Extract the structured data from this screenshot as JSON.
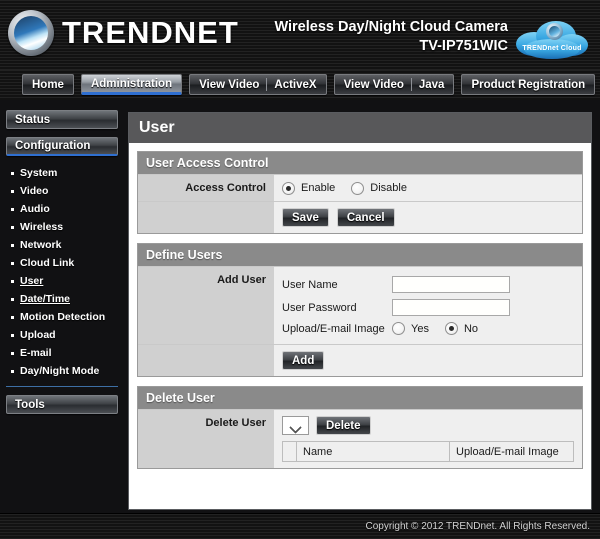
{
  "header": {
    "brand": "TRENDNET",
    "logo_icon": "trendnet-circle-logo",
    "product_line1": "Wireless Day/Night Cloud Camera",
    "product_line2": "TV-IP751WIC",
    "cloud_badge_label": "TRENDnet Cloud",
    "cloud_badge_icon": "cloud-icon"
  },
  "nav": {
    "tabs": [
      {
        "label": "Home",
        "active": false
      },
      {
        "label": "Administration",
        "active": true
      },
      {
        "label": "View Video",
        "label2": "ActiveX",
        "active": false
      },
      {
        "label": "View Video",
        "label2": "Java",
        "active": false
      },
      {
        "label": "Product Registration",
        "active": false
      }
    ]
  },
  "sidebar": {
    "status_label": "Status",
    "configuration_label": "Configuration",
    "tools_label": "Tools",
    "items": [
      {
        "label": "System",
        "active": false
      },
      {
        "label": "Video",
        "active": false
      },
      {
        "label": "Audio",
        "active": false
      },
      {
        "label": "Wireless",
        "active": false
      },
      {
        "label": "Network",
        "active": false
      },
      {
        "label": "Cloud Link",
        "active": false
      },
      {
        "label": "User",
        "active": true
      },
      {
        "label": "Date/Time",
        "active": true
      },
      {
        "label": "Motion Detection",
        "active": false
      },
      {
        "label": "Upload",
        "active": false
      },
      {
        "label": "E-mail",
        "active": false
      },
      {
        "label": "Day/Night Mode",
        "active": false
      }
    ]
  },
  "main": {
    "page_title": "User",
    "access_control": {
      "card_title": "User Access Control",
      "label": "Access Control",
      "enable_label": "Enable",
      "disable_label": "Disable",
      "selected": "Enable",
      "save_label": "Save",
      "cancel_label": "Cancel"
    },
    "define_users": {
      "card_title": "Define Users",
      "label": "Add User",
      "user_name_label": "User Name",
      "user_name_value": "",
      "user_password_label": "User Password",
      "user_password_value": "",
      "upload_email_label": "Upload/E-mail Image",
      "yes_label": "Yes",
      "no_label": "No",
      "selected": "No",
      "add_label": "Add"
    },
    "delete_user": {
      "card_title": "Delete User",
      "label": "Delete User",
      "select_value": "",
      "select_icon": "chevron-down-icon",
      "delete_label": "Delete",
      "table": {
        "columns": [
          "",
          "Name",
          "Upload/E-mail Image"
        ],
        "rows": []
      }
    }
  },
  "footer": {
    "copyright": "Copyright © 2012 TRENDnet.  All Rights Reserved."
  },
  "colors": {
    "accent_blue": "#2f6fd0",
    "panel_title_gray": "#58585a",
    "card_head_gray": "#8a8a8a",
    "label_col_gray": "#d0d0d0",
    "field_bg": "#efefef"
  }
}
